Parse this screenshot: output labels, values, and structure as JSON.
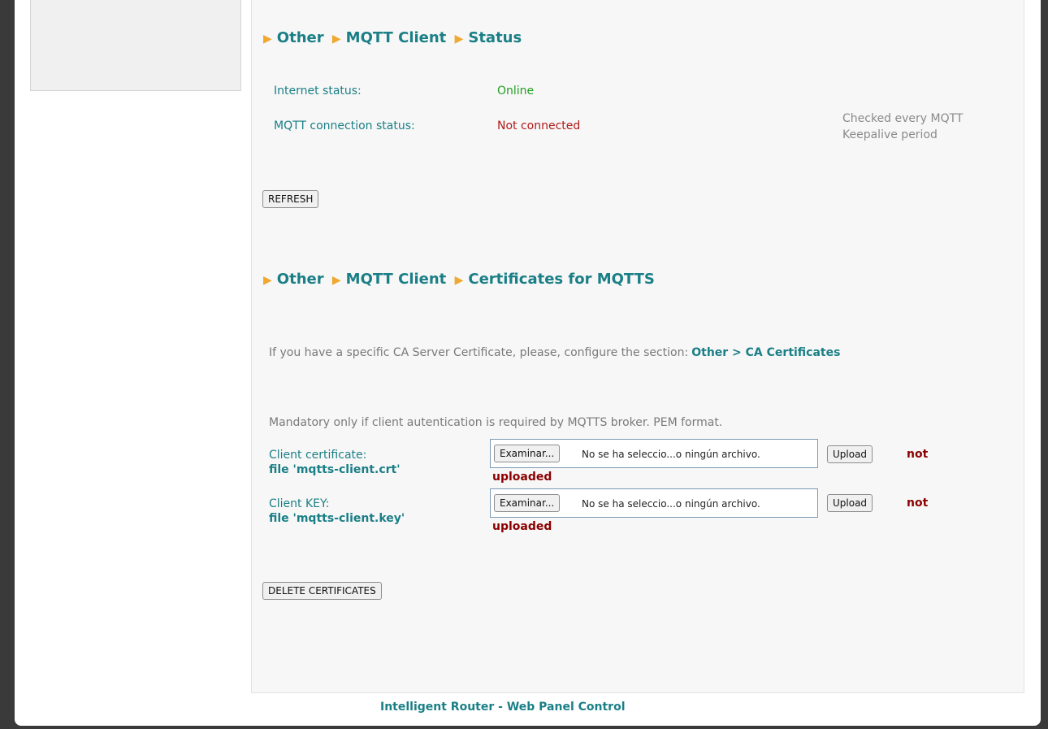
{
  "section1": {
    "crumbs": [
      "Other",
      "MQTT Client",
      "Status"
    ],
    "internet_label": "Internet status:",
    "internet_value": "Online",
    "mqtt_label": "MQTT connection status:",
    "mqtt_value": "Not connected",
    "note_line1": "Checked every MQTT",
    "note_line2": "Keepalive period",
    "refresh_label": "REFRESH"
  },
  "section2": {
    "crumbs": [
      "Other",
      "MQTT Client",
      "Certificates for MQTTS"
    ],
    "ca_info": "If you have a specific CA Server Certificate, please, configure the section:",
    "ca_link": "Other > CA Certificates",
    "mandatory_info": "Mandatory only if client autentication is required by MQTTS broker. PEM format.",
    "client_cert": {
      "label": "Client certificate:",
      "file": "file 'mqtts-client.crt'",
      "browse": "Examinar...",
      "no_file": "No se ha seleccio...o ningún archivo.",
      "upload": "Upload",
      "status_line1": "not",
      "status_line2": "uploaded"
    },
    "client_key": {
      "label": "Client KEY:",
      "file": "file 'mqtts-client.key'",
      "browse": "Examinar...",
      "no_file": "No se ha seleccio...o ningún archivo.",
      "upload": "Upload",
      "status_line1": "not",
      "status_line2": "uploaded"
    },
    "delete_label": "DELETE CERTIFICATES"
  },
  "footer": "Intelligent Router - Web Panel Control",
  "colors": {
    "accent": "#1a7f86",
    "arrow": "#f0a830",
    "online": "#22a022",
    "offline": "#b01a1a",
    "not_uploaded": "#8b0000"
  }
}
